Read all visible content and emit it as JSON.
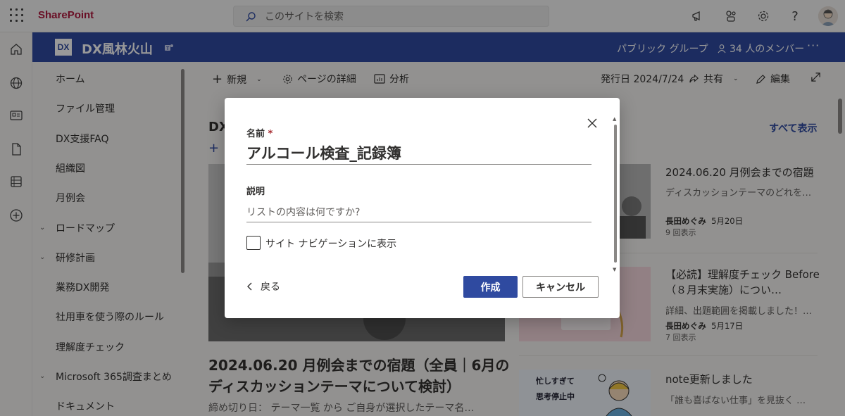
{
  "suite": {
    "brand": "SharePoint",
    "search_placeholder": "このサイトを検索"
  },
  "site": {
    "logo_text": "DX",
    "title": "DX風林火山",
    "group_type": "パブリック グループ",
    "members": "34 人のメンバー",
    "more": "···"
  },
  "nav": {
    "items": [
      {
        "label": "ホーム",
        "expandable": false
      },
      {
        "label": "ファイル管理",
        "expandable": false
      },
      {
        "label": "DX支援FAQ",
        "expandable": false
      },
      {
        "label": "組織図",
        "expandable": false
      },
      {
        "label": "月例会",
        "expandable": false
      },
      {
        "label": "ロードマップ",
        "expandable": true
      },
      {
        "label": "研修計画",
        "expandable": true
      },
      {
        "label": "業務DX開発",
        "expandable": false
      },
      {
        "label": "社用車を使う際のルール",
        "expandable": false
      },
      {
        "label": "理解度チェック",
        "expandable": false
      },
      {
        "label": "Microsoft 365調査まとめ",
        "expandable": true
      },
      {
        "label": "ドキュメント",
        "expandable": false
      }
    ]
  },
  "commandbar": {
    "new": "新規",
    "page_details": "ページの詳細",
    "analytics": "分析",
    "published": "発行日 2024/7/24",
    "share": "共有",
    "edit": "編集"
  },
  "page": {
    "section_label": "DX",
    "show_all": "すべて表示",
    "hero_title": "2024.06.20 月例会までの宿題（全員｜6月のディスカッションテーマについて検討）",
    "hero_desc": "締め切り日： テーマ一覧 から ご自身が選択したテーマ名…",
    "cards": [
      {
        "title": "2024.06.20 月例会までの宿題",
        "desc": "ディスカッションテーマのどれを…",
        "author": "長田めぐみ",
        "date": "5月20日",
        "views": "9 回表示"
      },
      {
        "title": "【必読】理解度チェック Before（８月末実施）につい…",
        "desc": "詳細、出題範囲を掲載しました！…",
        "author": "長田めぐみ",
        "date": "5月17日",
        "views": "7 回表示"
      },
      {
        "title": "note更新しました",
        "desc": "「誰も喜ばない仕事」を見抜く …",
        "thumb_text_1": "忙しすぎて",
        "thumb_text_2": "思考停止中"
      }
    ]
  },
  "dialog": {
    "name_label": "名前",
    "required_mark": "*",
    "name_value": "アルコール検査_記録簿",
    "desc_label": "説明",
    "desc_placeholder": "リストの内容は何ですか?",
    "checkbox_label": "サイト ナビゲーションに表示",
    "checkbox_checked": false,
    "back": "戻る",
    "create": "作成",
    "cancel": "キャンセル"
  },
  "colors": {
    "brand_red": "#b0193f",
    "site_blue": "#2f4aa0",
    "primary_button": "#2f4aa0"
  }
}
